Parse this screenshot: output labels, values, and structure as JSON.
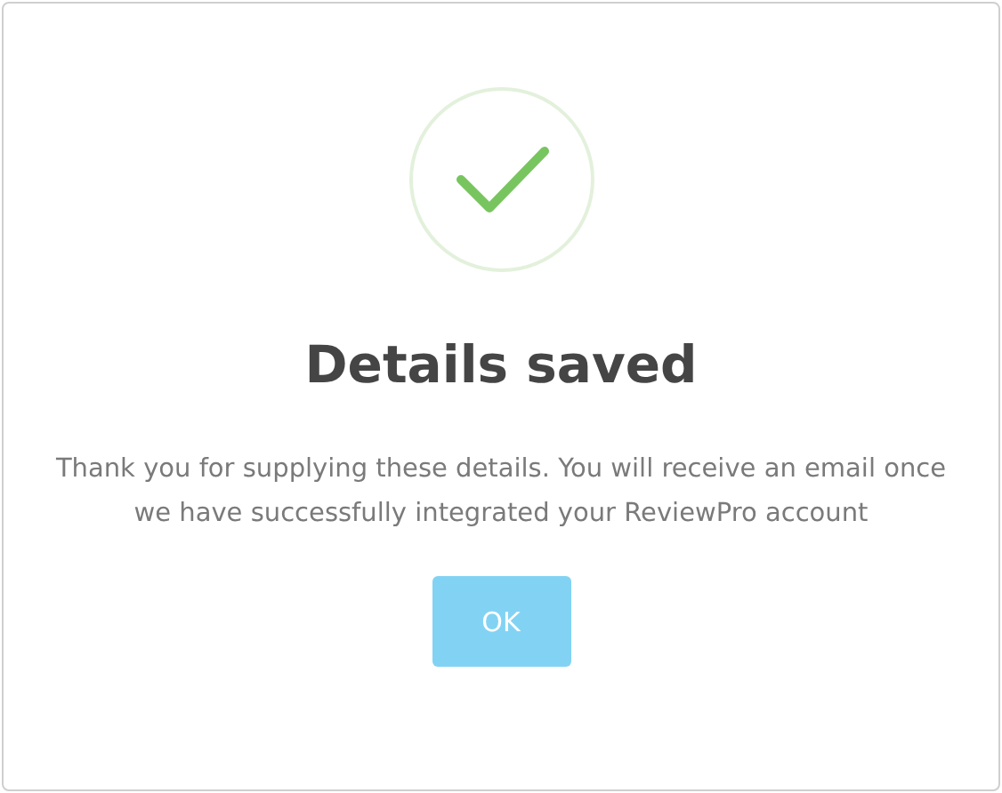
{
  "dialog": {
    "title": "Details saved",
    "message": "Thank you for supplying these details. You will receive an email once we have successfully integrated your ReviewPro account",
    "buttons": [
      {
        "label": "OK"
      }
    ]
  }
}
